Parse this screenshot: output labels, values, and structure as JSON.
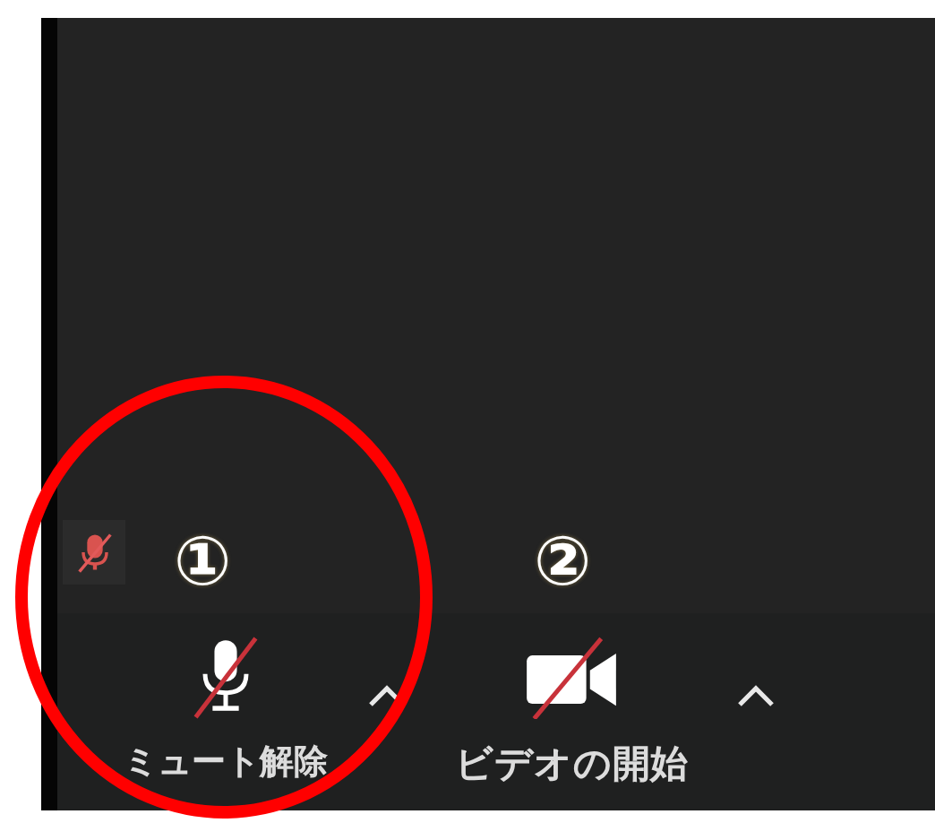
{
  "self_indicator": {
    "muted": true
  },
  "annotations": [
    {
      "label": "①"
    },
    {
      "label": "②"
    }
  ],
  "toolbar": {
    "controls": [
      {
        "kind": "microphone",
        "label": "ミュート解除",
        "off": true
      },
      {
        "kind": "camera",
        "label": "ビデオの開始",
        "off": true
      }
    ]
  },
  "highlight": {
    "kind": "circle"
  }
}
